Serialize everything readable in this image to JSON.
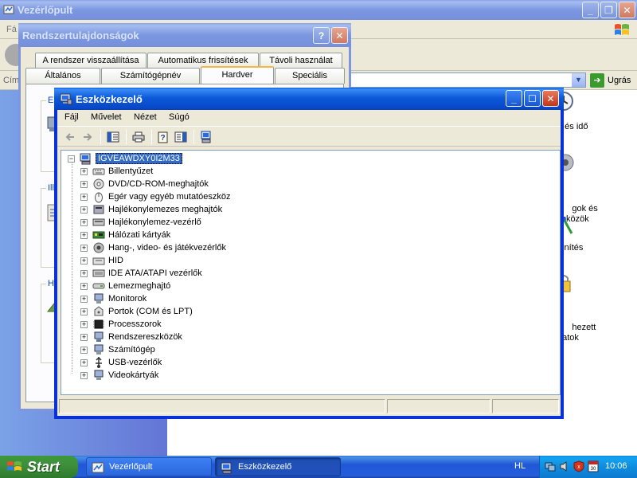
{
  "control_panel": {
    "title": "Vezérlőpult",
    "menu_partial": "Fá",
    "address_label_partial": "Cím",
    "go_label": "Ugrás",
    "items": [
      {
        "label": "n és idő"
      },
      {
        "label": "gok és\nszközök"
      },
      {
        "label": "lenítés"
      },
      {
        "label": "hezett\ndatok"
      }
    ],
    "left_panel_partial": [
      "Es",
      "Ille",
      "Ha"
    ]
  },
  "system_properties": {
    "title": "Rendszertulajdonságok",
    "tabs_row1": [
      "A rendszer visszaállítása",
      "Automatikus frissítések",
      "Távoli használat"
    ],
    "tabs_row2": [
      "Általános",
      "Számítógépnév",
      "Hardver",
      "Speciális"
    ],
    "active_tab": "Hardver",
    "groups_partial": [
      "Es",
      "Ille",
      "Ha"
    ]
  },
  "device_manager": {
    "title": "Eszközkezelő",
    "menu": [
      "Fájl",
      "Művelet",
      "Nézet",
      "Súgó"
    ],
    "toolbar": [
      "back-icon",
      "forward-icon",
      "show-hide-tree-icon",
      "print-icon",
      "help-properties-icon",
      "console-tree-icon",
      "computer-scan-icon"
    ],
    "tree": {
      "root": "IGVEAWDXY0I2M33",
      "children": [
        {
          "label": "Billentyűzet",
          "icon": "keyboard-icon"
        },
        {
          "label": "DVD/CD-ROM-meghajtók",
          "icon": "cdrom-icon"
        },
        {
          "label": "Egér vagy egyéb mutatóeszköz",
          "icon": "mouse-icon"
        },
        {
          "label": "Hajlékonylemezes meghajtók",
          "icon": "floppy-drive-icon"
        },
        {
          "label": "Hajlékonylemez-vezérlő",
          "icon": "floppy-controller-icon"
        },
        {
          "label": "Hálózati kártyák",
          "icon": "network-card-icon"
        },
        {
          "label": "Hang-, video- és játékvezérlők",
          "icon": "sound-icon"
        },
        {
          "label": "HID",
          "icon": "hid-icon"
        },
        {
          "label": "IDE ATA/ATAPI vezérlők",
          "icon": "ide-controller-icon"
        },
        {
          "label": "Lemezmeghajtó",
          "icon": "disk-drive-icon"
        },
        {
          "label": "Monitorok",
          "icon": "monitor-icon"
        },
        {
          "label": "Portok (COM és LPT)",
          "icon": "port-icon"
        },
        {
          "label": "Processzorok",
          "icon": "processor-icon"
        },
        {
          "label": "Rendszereszközök",
          "icon": "system-device-icon"
        },
        {
          "label": "Számítógép",
          "icon": "computer-icon"
        },
        {
          "label": "USB-vezérlők",
          "icon": "usb-icon"
        },
        {
          "label": "Videokártyák",
          "icon": "video-card-icon"
        }
      ]
    }
  },
  "taskbar": {
    "start_label": "Start",
    "tasks": [
      {
        "label": "Vezérlőpult"
      },
      {
        "label": "Eszközkezelő"
      }
    ],
    "language": "HL",
    "clock": "10:06"
  }
}
